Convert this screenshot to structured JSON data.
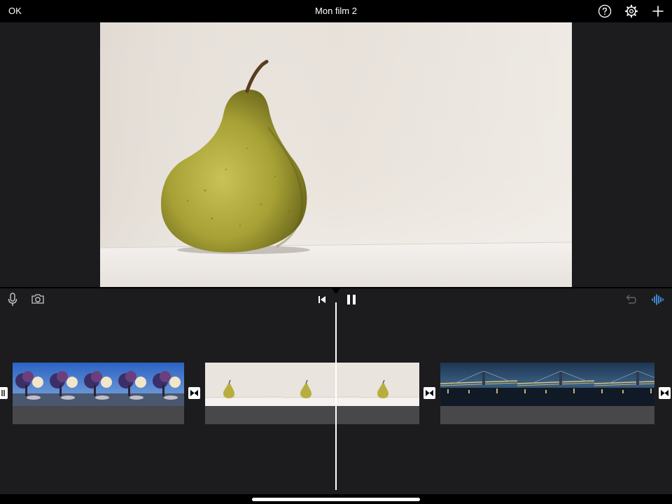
{
  "topbar": {
    "done_label": "OK",
    "title": "Mon film 2",
    "icons": [
      "help-icon",
      "gear-icon",
      "plus-icon"
    ]
  },
  "viewer": {
    "subject": "pear"
  },
  "toolbar": {
    "left_icons": [
      "microphone-icon",
      "camera-icon"
    ],
    "center_icons": [
      "skip-to-start-icon",
      "pause-icon"
    ],
    "right_icons": [
      "undo-icon",
      "audio-waveform-icon"
    ],
    "accent_color": "#4aa3ff"
  },
  "timeline": {
    "clips": [
      {
        "name": "clip-street-tree"
      },
      {
        "name": "clip-pear"
      },
      {
        "name": "clip-bridge-night"
      }
    ]
  },
  "colors": {
    "background": "#1c1c1e",
    "bar": "#000000",
    "audio_track": "#48484a"
  }
}
